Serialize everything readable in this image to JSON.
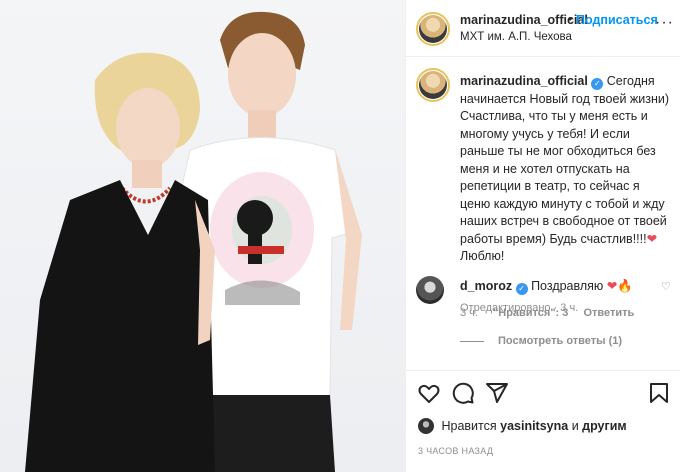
{
  "header": {
    "username": "marinazudina_official",
    "separator": "•",
    "follow_label": "Подписаться",
    "location": "МХТ им. А.П. Чехова",
    "more_glyph": "···"
  },
  "caption": {
    "username": "marinazudina_official",
    "text": "Сегодня начинается Новый год твоей жизни) Счастлива, что ты у меня есть и многому учусь у тебя! И если раньше ты не мог обходиться без меня и не хотел отпускать на репетиции в театр, то сейчас я ценю каждую минуту с тобой и жду наших встреч в свободное от твоей работы время) Будь счастлив!!!!",
    "heart": "❤",
    "tail": " Люблю!",
    "meta": "Отредактировано · 3 ч."
  },
  "comment": {
    "username": "d_moroz",
    "text": "Поздравляю ",
    "emoji_heart": "❤",
    "emoji_fire": "🔥",
    "time": "3 ч.",
    "likes": "\"Нравится\": 3",
    "reply": "Ответить",
    "view_replies": "Посмотреть ответы (1)"
  },
  "likes": {
    "prefix": "Нравится ",
    "user": "yasinitsyna",
    "middle": " и ",
    "others": "другим"
  },
  "timestamp": "3 ЧАСОВ НАЗАД",
  "icons": {
    "like": "heart-outline-icon",
    "comment": "comment-icon",
    "share": "share-icon",
    "save": "bookmark-icon"
  },
  "colors": {
    "accent": "#0095f6",
    "verified": "#3897f0",
    "heart": "#ed4956",
    "muted": "#8e8e8e"
  }
}
